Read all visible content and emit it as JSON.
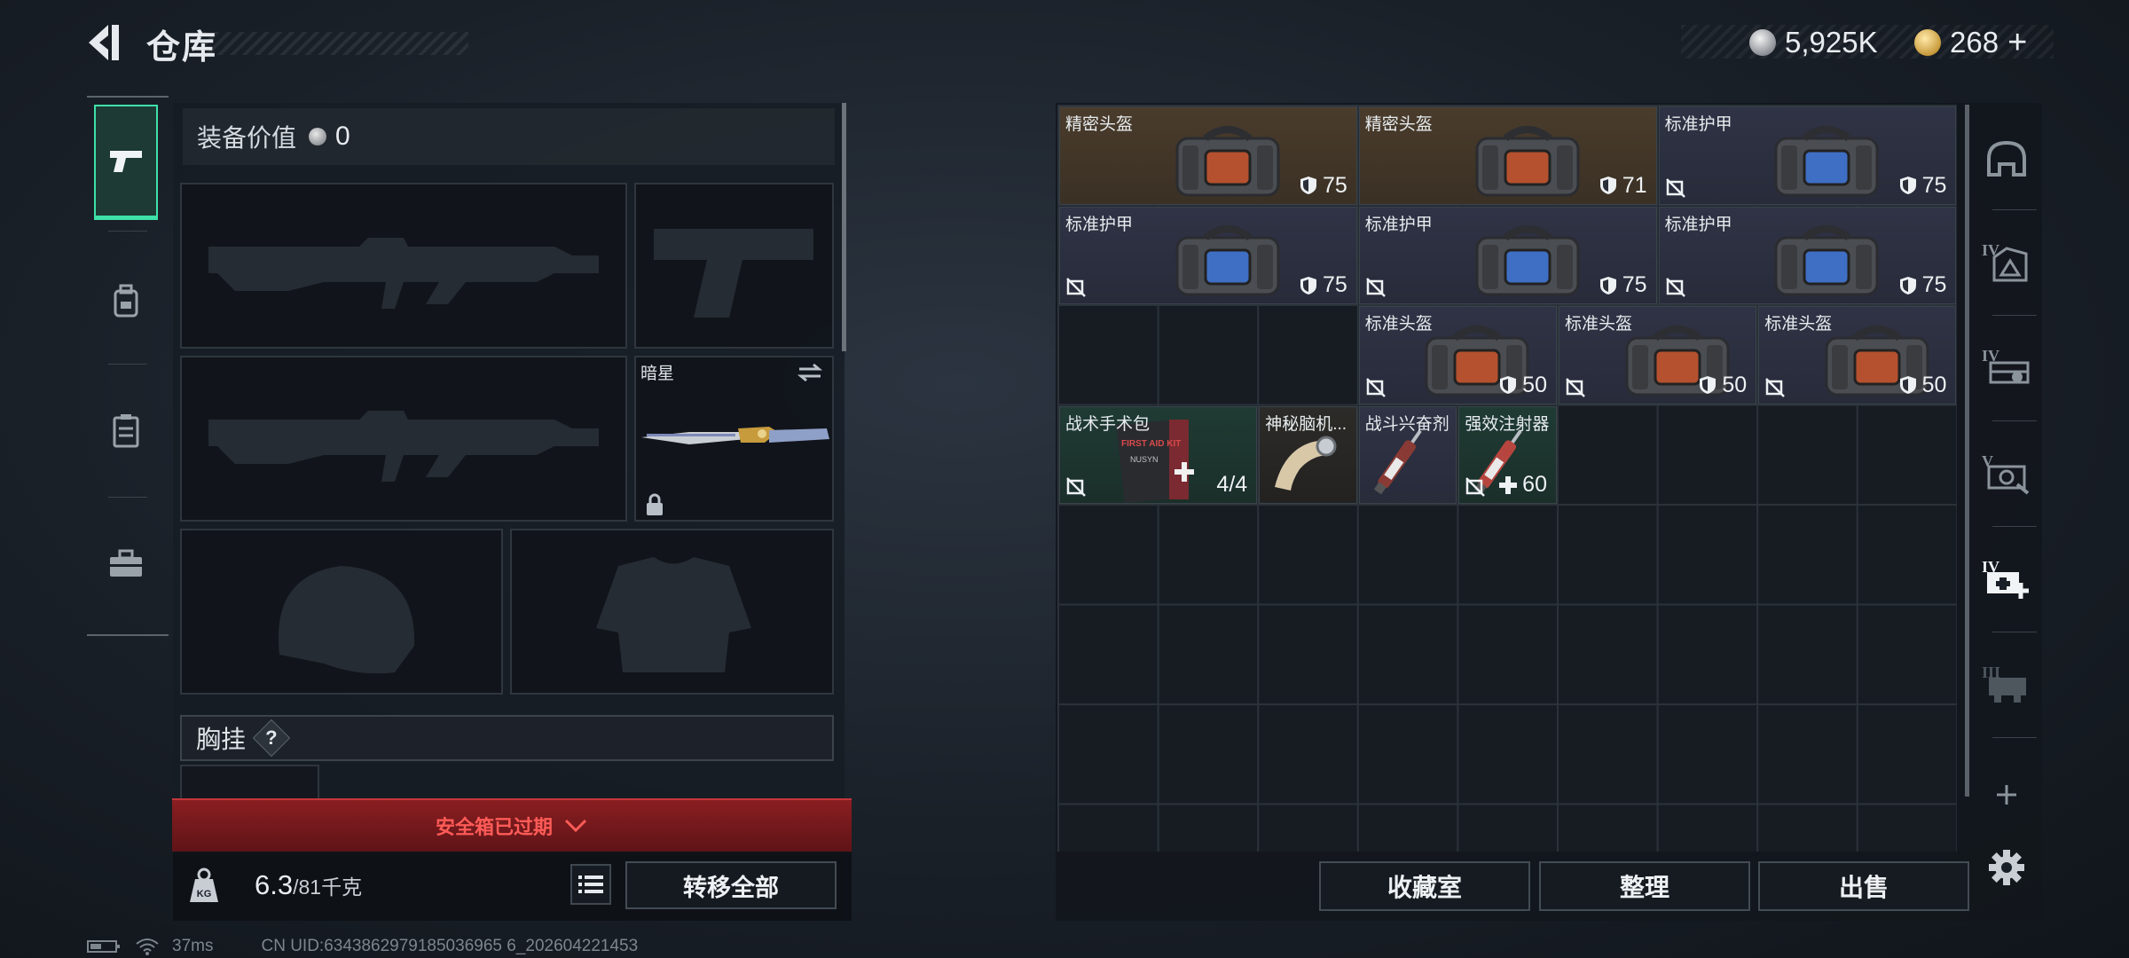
{
  "header": {
    "title": "仓库"
  },
  "currency": {
    "silver": "5,925K",
    "gold": "268",
    "gold_add": "+"
  },
  "sidebar": {
    "categories": [
      {
        "name": "pistol-icon",
        "active": true
      },
      {
        "name": "backpack-icon",
        "active": false
      },
      {
        "name": "vest-icon",
        "active": false
      },
      {
        "name": "toolbox-icon",
        "active": false
      }
    ]
  },
  "equipment": {
    "value_label": "装备价值",
    "value": "0",
    "melee_name": "暗星",
    "chest_label": "胸挂",
    "chest_help": "?",
    "safebox_warning": "安全箱已过期",
    "weight_current": "6.3",
    "weight_max": "/81",
    "weight_unit": "千克",
    "transfer_all": "转移全部"
  },
  "inventory": {
    "items": [
      {
        "name": "精密头盔",
        "durability": "75",
        "style": "brown",
        "type": "helmet"
      },
      {
        "name": "精密头盔",
        "durability": "71",
        "style": "brown",
        "type": "helmet"
      },
      {
        "name": "标准护甲",
        "durability": "75",
        "style": "blue",
        "type": "armor"
      },
      {
        "name": "标准护甲",
        "durability": "75",
        "style": "blue",
        "type": "armor"
      },
      {
        "name": "标准护甲",
        "durability": "75",
        "style": "blue",
        "type": "armor"
      },
      {
        "name": "标准护甲",
        "durability": "75",
        "style": "blue",
        "type": "armor"
      },
      {
        "name": "标准头盔",
        "durability": "50",
        "style": "blue",
        "type": "helmet"
      },
      {
        "name": "标准头盔",
        "durability": "50",
        "style": "blue",
        "type": "helmet"
      },
      {
        "name": "标准头盔",
        "durability": "50",
        "style": "blue",
        "type": "helmet"
      },
      {
        "name": "战术手术包",
        "count": "4/4",
        "style": "green",
        "type": "medkit",
        "kit_text": "FIRST AID KIT",
        "brand": "NUSYN"
      },
      {
        "name": "神秘脑机...",
        "style": "dark",
        "type": "brain"
      },
      {
        "name": "战斗兴奋剂",
        "style": "blue",
        "type": "syringe"
      },
      {
        "name": "强效注射器",
        "count": "60",
        "style": "green",
        "type": "injector"
      }
    ]
  },
  "actions": {
    "collection": "收藏室",
    "organize": "整理",
    "sell": "出售"
  },
  "right_filters": [
    "helmet-filter-icon",
    "armor-filter-icon",
    "rig-filter-icon",
    "gear-filter-icon",
    "medical-filter-icon",
    "bag-filter-icon",
    "add-icon",
    "settings-icon"
  ],
  "status": {
    "ping": "37ms",
    "uid": "CN UID:6343862979185036965 6_202604221453"
  }
}
